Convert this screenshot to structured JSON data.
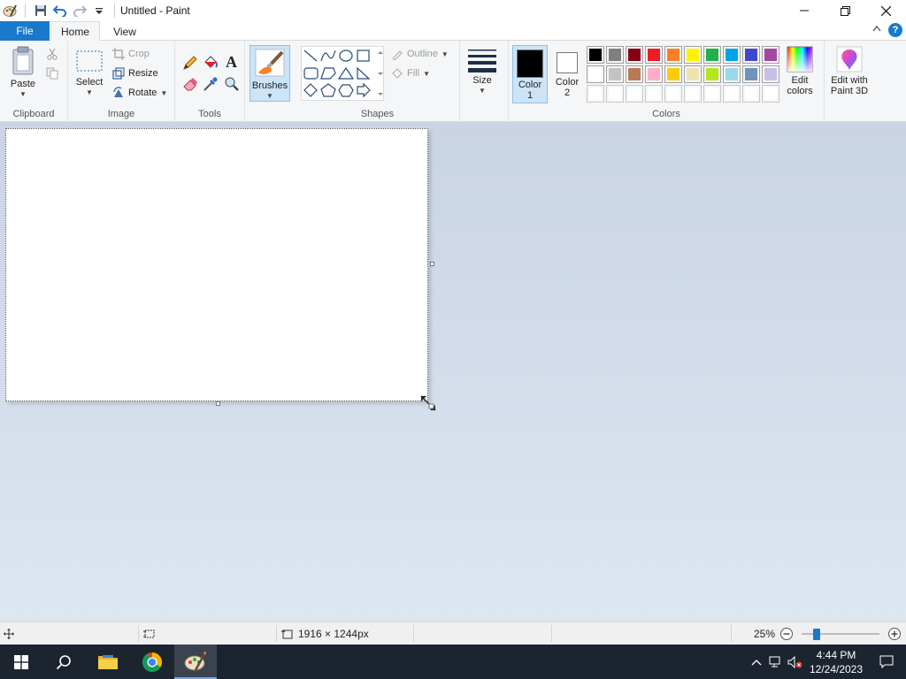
{
  "window": {
    "title": "Untitled - Paint"
  },
  "tabs": {
    "file": "File",
    "home": "Home",
    "view": "View",
    "help": "?"
  },
  "ribbon": {
    "clipboard": {
      "label": "Clipboard",
      "paste": "Paste"
    },
    "image": {
      "label": "Image",
      "select": "Select",
      "crop": "Crop",
      "resize": "Resize",
      "rotate": "Rotate"
    },
    "tools": {
      "label": "Tools",
      "brushes": "Brushes"
    },
    "shapes": {
      "label": "Shapes",
      "outline": "Outline",
      "fill": "Fill"
    },
    "size": {
      "label": "Size"
    },
    "colors": {
      "label": "Colors",
      "color1_line1": "Color",
      "color1_line2": "1",
      "color2_line1": "Color",
      "color2_line2": "2",
      "edit_line1": "Edit",
      "edit_line2": "colors",
      "color1_value": "#000000",
      "color2_value": "#ffffff",
      "palette_row1": [
        "#000000",
        "#7f7f7f",
        "#880015",
        "#ed1c24",
        "#ff7f27",
        "#fff200",
        "#22b14c",
        "#00a2e8",
        "#3f48cc",
        "#a349a4"
      ],
      "palette_row2": [
        "#ffffff",
        "#c3c3c3",
        "#b97a57",
        "#ffaec9",
        "#ffc90e",
        "#efe4b0",
        "#b5e61d",
        "#99d9ea",
        "#7092be",
        "#c8bfe7"
      ],
      "palette_row3": [
        "#ffffff",
        "#ffffff",
        "#ffffff",
        "#ffffff",
        "#ffffff",
        "#ffffff",
        "#ffffff",
        "#ffffff",
        "#ffffff",
        "#ffffff"
      ]
    },
    "paint3d": {
      "line1": "Edit with",
      "line2": "Paint 3D"
    }
  },
  "status": {
    "image_size": "1916 × 1244px",
    "zoom": "25%",
    "zoom_level_percent": 25
  },
  "taskbar": {
    "time": "4:44 PM",
    "date": "12/24/2023"
  }
}
